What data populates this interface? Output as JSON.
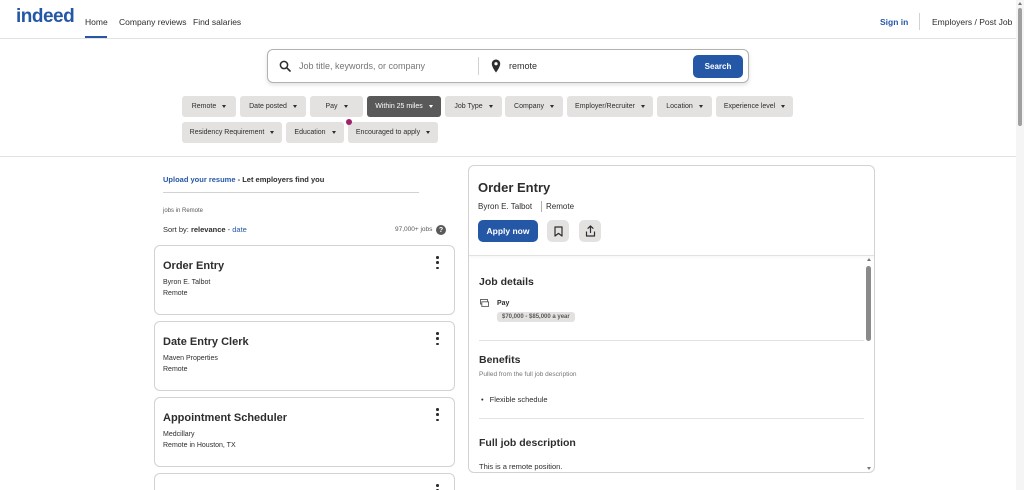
{
  "header": {
    "logo": "indeed",
    "nav": [
      "Home",
      "Company reviews",
      "Find salaries"
    ],
    "signin": "Sign in",
    "employers": "Employers / Post Job"
  },
  "search": {
    "what_placeholder": "Job title, keywords, or company",
    "where_value": "remote",
    "button": "Search"
  },
  "filters": [
    {
      "label": "Remote",
      "active": false
    },
    {
      "label": "Date posted",
      "active": false
    },
    {
      "label": "Pay",
      "active": false
    },
    {
      "label": "Within 25 miles",
      "active": true
    },
    {
      "label": "Job Type",
      "active": false
    },
    {
      "label": "Company",
      "active": false
    },
    {
      "label": "Employer/Recruiter",
      "active": false
    },
    {
      "label": "Location",
      "active": false
    },
    {
      "label": "Experience level",
      "active": false
    },
    {
      "label": "Residency Requirement",
      "active": false
    },
    {
      "label": "Education",
      "active": false
    },
    {
      "label": "Encouraged to apply",
      "active": false
    }
  ],
  "results": {
    "upload_link": "Upload your resume",
    "upload_rest": " - Let employers find you",
    "jobs_in": "jobs in Remote",
    "sort_prefix": "Sort by: ",
    "sort_relevance": "relevance",
    "sort_sep": " - ",
    "sort_date": "date",
    "count": "97,000+ jobs",
    "help": "?"
  },
  "jobs": [
    {
      "title": "Order Entry",
      "company": "Byron E. Talbot",
      "location": "Remote"
    },
    {
      "title": "Date Entry Clerk",
      "company": "Maven Properties",
      "location": "Remote"
    },
    {
      "title": "Appointment Scheduler",
      "company": "Medcillary",
      "location": "Remote in Houston, TX"
    }
  ],
  "detail": {
    "title": "Order Entry",
    "company": "Byron E. Talbot",
    "location": "Remote",
    "apply": "Apply now",
    "job_details_title": "Job details",
    "pay_label": "Pay",
    "pay_value": "$70,000 - $85,000 a year",
    "benefits_title": "Benefits",
    "benefits_sub": "Pulled from the full job description",
    "benefits": [
      "Flexible schedule"
    ],
    "desc_title": "Full job description",
    "desc_text": "This is a remote position."
  },
  "colors": {
    "brand": "#2557a7",
    "chip": "#e4e2e0",
    "chip_active": "#595959",
    "notification_dot": "#a0216b"
  }
}
